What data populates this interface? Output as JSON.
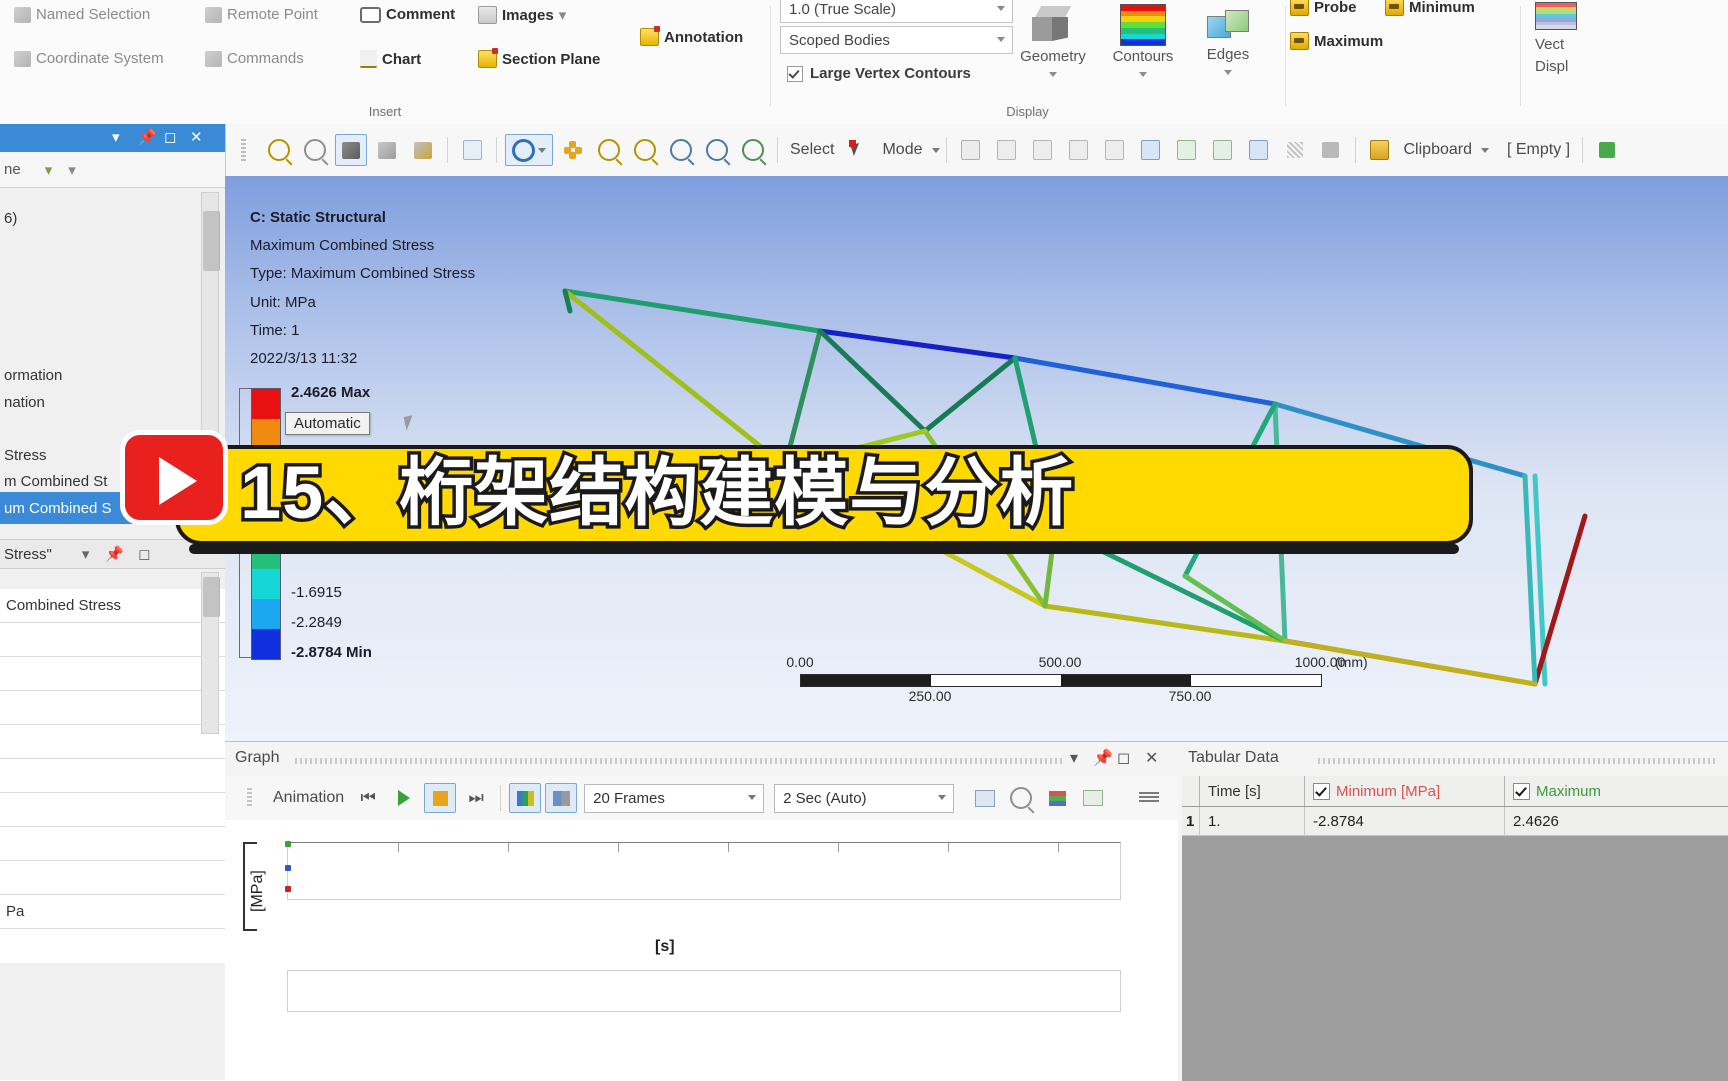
{
  "ribbon": {
    "insert_group": {
      "caption": "Insert",
      "items": [
        {
          "label": "Named Selection",
          "icon": "named-selection-icon",
          "enabled": false
        },
        {
          "label": "Remote Point",
          "icon": "remote-point-icon",
          "enabled": false
        },
        {
          "label": "Comment",
          "icon": "comment-icon",
          "enabled": true
        },
        {
          "label": "Images",
          "icon": "images-icon",
          "enabled": true,
          "caret": "▾"
        },
        {
          "label": "Coordinate System",
          "icon": "coordinate-system-icon",
          "enabled": false
        },
        {
          "label": "Commands",
          "icon": "commands-icon",
          "enabled": false
        },
        {
          "label": "Chart",
          "icon": "chart-icon",
          "enabled": true
        },
        {
          "label": "Section Plane",
          "icon": "section-plane-icon",
          "enabled": true
        },
        {
          "label": "Annotation",
          "icon": "annotation-icon",
          "enabled": true
        }
      ]
    },
    "display_group": {
      "caption": "Display",
      "scale_value": "1.0 (True Scale)",
      "scope_value": "Scoped Bodies",
      "checkbox_label": "Large Vertex Contours",
      "buttons": [
        {
          "label": "Geometry",
          "icon": "geometry-cube-icon"
        },
        {
          "label": "Contours",
          "icon": "contours-spectrum-icon"
        },
        {
          "label": "Edges",
          "icon": "edges-icon"
        }
      ]
    },
    "annotation_group": {
      "items": [
        {
          "label": "Probe",
          "icon": "probe-icon"
        },
        {
          "label": "Minimum",
          "icon": "minimum-icon"
        },
        {
          "label": "Maximum",
          "icon": "maximum-icon"
        }
      ]
    },
    "vector_group": {
      "label_line1": "Vect",
      "label_line2": "Displ"
    }
  },
  "toolbar": {
    "select_label": "Select",
    "mode_label": "Mode",
    "mode_caret": "▾",
    "clipboard_label": "Clipboard",
    "clipboard_caret": "▾",
    "empty_label": "[ Empty ]"
  },
  "tree_panel": {
    "rows": [
      {
        "label": "6)",
        "selected": false
      },
      {
        "label": "ormation",
        "selected": false
      },
      {
        "label": "nation",
        "selected": false
      },
      {
        "label": "Stress",
        "selected": false
      },
      {
        "label": "m Combined St",
        "selected": false
      },
      {
        "label": "um Combined S",
        "selected": true
      }
    ],
    "details_title": "Stress\"",
    "details_rows": [
      {
        "label": "Combined Stress"
      },
      {
        "label": ""
      },
      {
        "label": ""
      },
      {
        "label": ""
      },
      {
        "label": ""
      },
      {
        "label": ""
      },
      {
        "label": "Pa"
      }
    ]
  },
  "viewport": {
    "header_lines": [
      "C: Static Structural",
      "Maximum Combined Stress",
      "Type: Maximum Combined Stress",
      "Unit: MPa",
      "Time: 1",
      "2022/3/13 11:32"
    ],
    "legend_values": [
      {
        "text": "2.4626 Max",
        "bold": true
      },
      {
        "text": "-1.6915",
        "bold": false
      },
      {
        "text": "-2.2849",
        "bold": false
      },
      {
        "text": "-2.8784 Min",
        "bold": true
      }
    ],
    "tooltip": "Automatic",
    "colorbar_colors": [
      "#e81010",
      "#f08a10",
      "#f0d010",
      "#d8ec18",
      "#66dd33",
      "#22c07a",
      "#16d6d6",
      "#1aa8f0",
      "#1030e0"
    ],
    "scale_top_labels": [
      "0.00",
      "500.00"
    ],
    "scale_bottom_labels": [
      "250.00",
      "750.00"
    ],
    "scale_last_top": "1000.00",
    "scale_unit": "(mm)"
  },
  "graph_panel": {
    "title": "Graph",
    "controls": [
      "▾",
      "☰",
      "□",
      "✕"
    ],
    "animation_label": "Animation",
    "frames_value": "20 Frames",
    "duration_value": "2 Sec (Auto)",
    "y_axis_label": "[MPa]",
    "x_axis_label": "[s]"
  },
  "tabular_panel": {
    "title": "Tabular Data",
    "columns": [
      "Time [s]",
      "Minimum [MPa]",
      "Maximum"
    ],
    "rows": [
      {
        "index": "1",
        "time": "1.",
        "minimum": "-2.8784",
        "maximum": "2.4626"
      }
    ],
    "min_color": "#d9534f",
    "max_color": "#3c9a3c"
  },
  "overlay": {
    "title": "15、桁架结构建模与分析",
    "play_icon": "play-button-icon",
    "bar_color": "#ffd900"
  }
}
